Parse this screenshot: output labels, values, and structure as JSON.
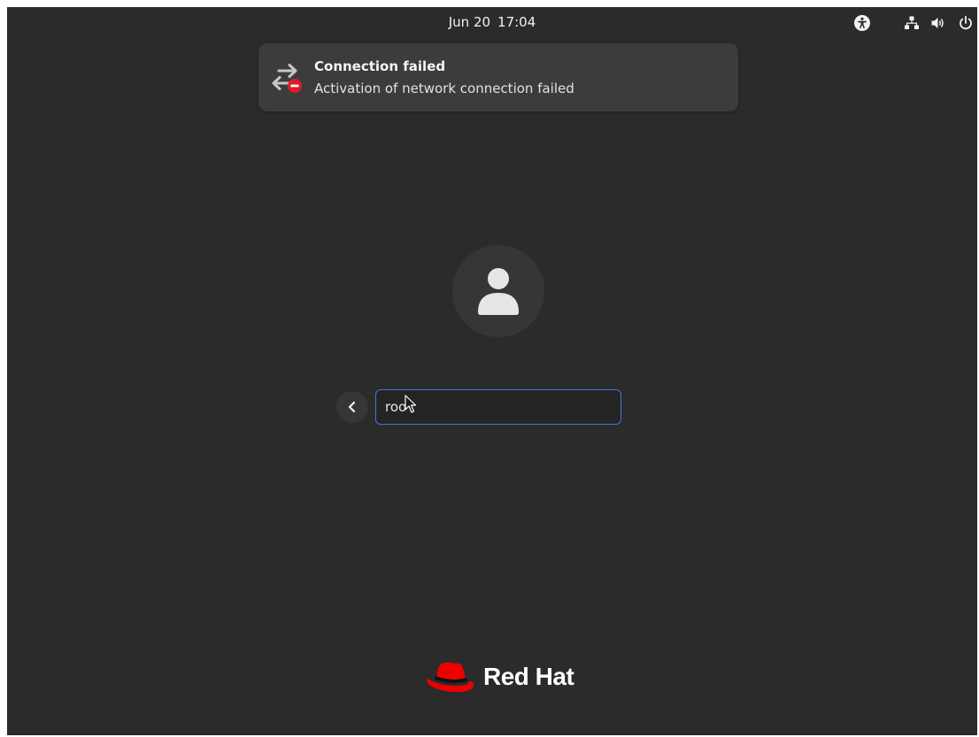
{
  "topbar": {
    "date": "Jun 20",
    "time": "17:04",
    "icons": [
      "accessibility-icon",
      "network-wired-icon",
      "volume-icon",
      "power-icon"
    ]
  },
  "notification": {
    "icon": "network-error-icon",
    "title": "Connection failed",
    "body": "Activation of network connection failed"
  },
  "login": {
    "avatar_icon": "user-avatar-icon",
    "back_icon": "chevron-left-icon",
    "username_value": "roo"
  },
  "branding": {
    "logo_text": "Red Hat",
    "logo_color": "#ee0000"
  },
  "colors": {
    "background": "#2b2b2b",
    "input_focus": "#3b7bd8"
  }
}
